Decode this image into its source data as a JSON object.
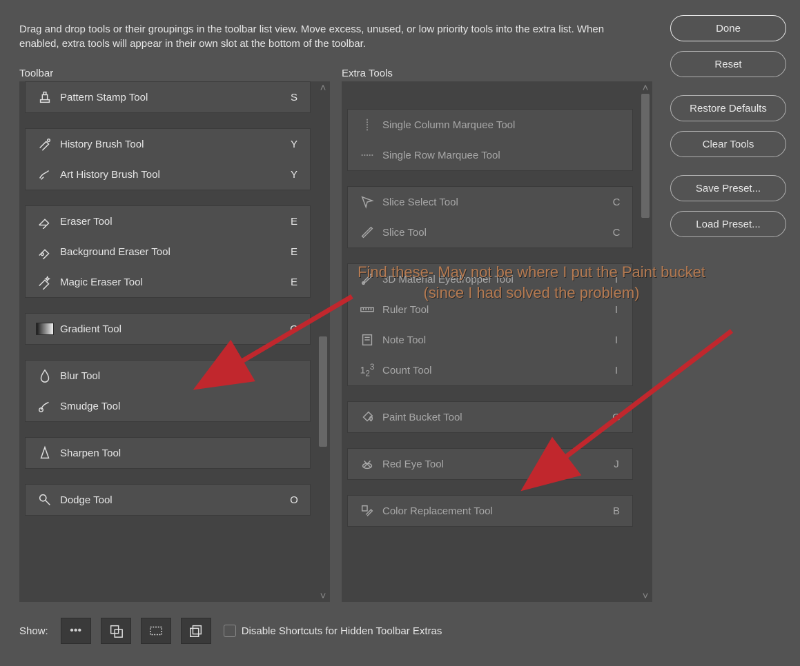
{
  "intro": "Drag and drop tools or their groupings in the toolbar list view. Move excess, unused, or low priority tools into the extra list. When enabled, extra tools will appear in their own slot at the bottom of the toolbar.",
  "headers": {
    "toolbar": "Toolbar",
    "extra": "Extra Tools"
  },
  "toolbar_groups": [
    {
      "items": [
        {
          "icon": "pattern-stamp",
          "label": "Pattern Stamp Tool",
          "key": "S"
        }
      ]
    },
    {
      "items": [
        {
          "icon": "history-brush",
          "label": "History Brush Tool",
          "key": "Y"
        },
        {
          "icon": "art-history-brush",
          "label": "Art History Brush Tool",
          "key": "Y"
        }
      ]
    },
    {
      "items": [
        {
          "icon": "eraser",
          "label": "Eraser Tool",
          "key": "E"
        },
        {
          "icon": "background-eraser",
          "label": "Background Eraser Tool",
          "key": "E"
        },
        {
          "icon": "magic-eraser",
          "label": "Magic Eraser Tool",
          "key": "E"
        }
      ]
    },
    {
      "items": [
        {
          "icon": "gradient",
          "label": "Gradient Tool",
          "key": "G"
        }
      ]
    },
    {
      "items": [
        {
          "icon": "blur",
          "label": "Blur Tool",
          "key": ""
        },
        {
          "icon": "smudge",
          "label": "Smudge Tool",
          "key": ""
        }
      ]
    },
    {
      "items": [
        {
          "icon": "sharpen",
          "label": "Sharpen Tool",
          "key": ""
        }
      ]
    },
    {
      "items": [
        {
          "icon": "dodge",
          "label": "Dodge Tool",
          "key": "O"
        }
      ]
    }
  ],
  "extra_groups": [
    {
      "items": [
        {
          "icon": "single-col-marquee",
          "label": "Single Column Marquee Tool",
          "key": ""
        },
        {
          "icon": "single-row-marquee",
          "label": "Single Row Marquee Tool",
          "key": ""
        }
      ]
    },
    {
      "items": [
        {
          "icon": "slice-select",
          "label": "Slice Select Tool",
          "key": "C"
        },
        {
          "icon": "slice",
          "label": "Slice Tool",
          "key": "C"
        }
      ]
    },
    {
      "items": [
        {
          "icon": "3d-eyedropper",
          "label": "3D Material Eyedropper Tool",
          "key": "I"
        },
        {
          "icon": "ruler",
          "label": "Ruler Tool",
          "key": "I"
        },
        {
          "icon": "note",
          "label": "Note Tool",
          "key": "I"
        },
        {
          "icon": "count",
          "label": "Count Tool",
          "key": "I"
        }
      ]
    },
    {
      "items": [
        {
          "icon": "paint-bucket",
          "label": "Paint Bucket Tool",
          "key": "G"
        }
      ]
    },
    {
      "items": [
        {
          "icon": "red-eye",
          "label": "Red Eye Tool",
          "key": "J"
        }
      ]
    },
    {
      "items": [
        {
          "icon": "color-replacement",
          "label": "Color Replacement Tool",
          "key": "B"
        }
      ]
    }
  ],
  "buttons": {
    "done": "Done",
    "reset": "Reset",
    "restore": "Restore Defaults",
    "clear": "Clear Tools",
    "save": "Save Preset...",
    "load": "Load Preset..."
  },
  "bottom": {
    "show": "Show:",
    "chips": [
      "dots",
      "overlap",
      "dashed-rect",
      "stack"
    ],
    "checkbox_label": "Disable Shortcuts for Hidden Toolbar Extras"
  },
  "annotation": "Find these- May not be where I put the Paint bucket (since I had solved the problem)"
}
